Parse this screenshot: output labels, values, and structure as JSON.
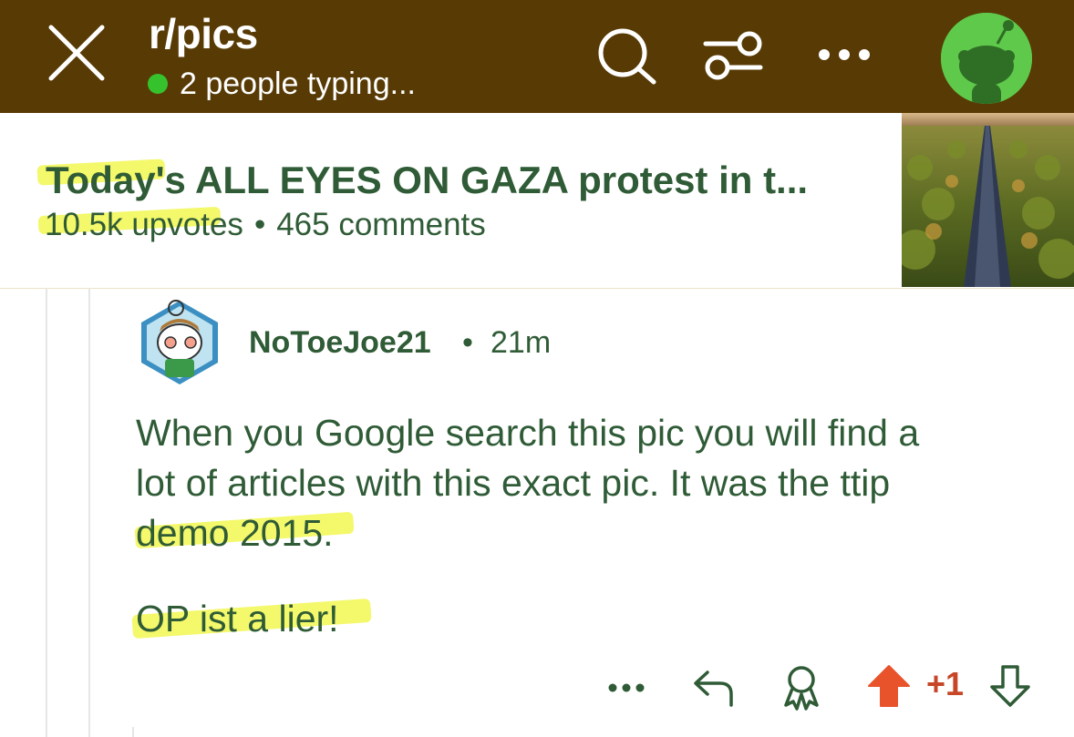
{
  "header": {
    "subreddit": "r/pics",
    "typing_status": "2 people typing...",
    "icons": [
      "close-icon",
      "search-icon",
      "filter-icon",
      "more-icon",
      "avatar-icon"
    ],
    "background_color": "#583a05"
  },
  "post": {
    "title": "Today's ALL EYES ON GAZA protest in t...",
    "upvotes": "10.5k upvotes",
    "separator": "•",
    "comments": "465 comments"
  },
  "comment": {
    "author": "NoToeJoe21",
    "separator": "•",
    "time": "21m",
    "body_lines": [
      "When you Google search this pic you will find a",
      "lot of articles with this exact pic. It was the ttip",
      "demo 2015.",
      "OP ist a lier!"
    ],
    "actions": {
      "icons": [
        "more-icon",
        "reply-icon",
        "award-icon",
        "upvote-icon",
        "downvote-icon"
      ],
      "vote_count": "+1"
    }
  },
  "colors": {
    "text_green": "#2f5b36",
    "highlight": "#f3f75b",
    "upvote": "#e8532c",
    "online_dot": "#36c22d"
  }
}
